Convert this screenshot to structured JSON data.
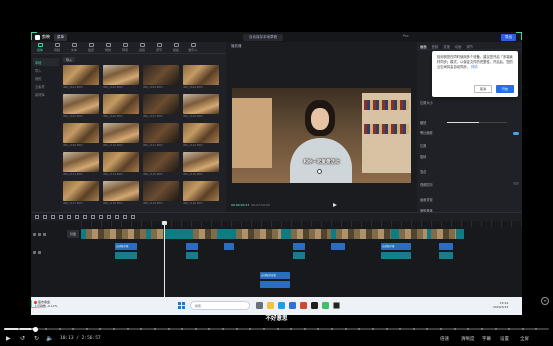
{
  "app": {
    "name": "剪映",
    "menu_label": "菜单",
    "project_title": "自动保存本地草稿",
    "export_label": "导出",
    "title_right": "Pro"
  },
  "media": {
    "tabs": [
      "媒体",
      "音频",
      "文本",
      "贴纸",
      "特效",
      "转场",
      "滤镜",
      "调节",
      "模板",
      "数字人"
    ],
    "active_tab": "媒体",
    "side_items": [
      "本地",
      "导入",
      "我的",
      "云素材",
      "素材库"
    ],
    "import_label": "导入",
    "thumbnails": [
      "IMG_1101.MOV",
      "IMG_1102.MOV",
      "IMG_1103.MOV",
      "IMG_1104.MOV",
      "IMG_1105.MOV",
      "IMG_1106.MOV",
      "IMG_1107.MOV",
      "IMG_1108.MOV",
      "IMG_1109.MOV",
      "IMG_1110.MOV",
      "IMG_1111.MOV",
      "IMG_1112.MOV",
      "IMG_1113.MOV",
      "IMG_1114.MOV",
      "IMG_1115.MOV",
      "IMG_1116.MOV",
      "IMG_1117.MOV",
      "IMG_1118.MOV",
      "IMG_1119.MOV",
      "IMG_1120.MOV"
    ]
  },
  "player": {
    "header": "播放器",
    "subtitle": "和你一起复盘活动",
    "time_current": "00:00:00:17",
    "time_total": "00:03:54:00"
  },
  "props": {
    "tabs": [
      "画面",
      "音频",
      "变速",
      "动画",
      "调节"
    ],
    "rows": [
      "位置大小",
      "缩放",
      "等比缩放",
      "位置",
      "旋转",
      "混合",
      "视频防抖",
      "画面背景",
      "美颜美体"
    ]
  },
  "popup": {
    "text": "检测到您在同时使用多个设备，建议您开启「多端素材同步」模式，以保证文件的完整性，开启后，您的云空间将会自动同步。",
    "link": "详情",
    "cancel": "取消",
    "confirm": "开启"
  },
  "timeline": {
    "cover_label": "封面",
    "main_track_label": "主轨道",
    "clip_label": "自动配字幕",
    "audio_clip_label": "自动配音效果"
  },
  "taskbar": {
    "notify_title": "股市收盘",
    "notify_sub": "上证指数 -0.12%",
    "search_placeholder": "搜索",
    "tray_time": "15:41",
    "tray_date": "2024/3/12"
  },
  "video_player": {
    "caption": "不好意思",
    "timecode": "10:13 / 2:56:57",
    "progress": 0.058,
    "right_controls": [
      "倍速",
      "清晰度",
      "字幕",
      "设置",
      "全屏"
    ]
  },
  "colors": {
    "accent": "#3fd7a8",
    "export_blue": "#2b5fe8",
    "clip_blue": "#2a6cc0",
    "main_track_teal": "#0f7c84"
  }
}
